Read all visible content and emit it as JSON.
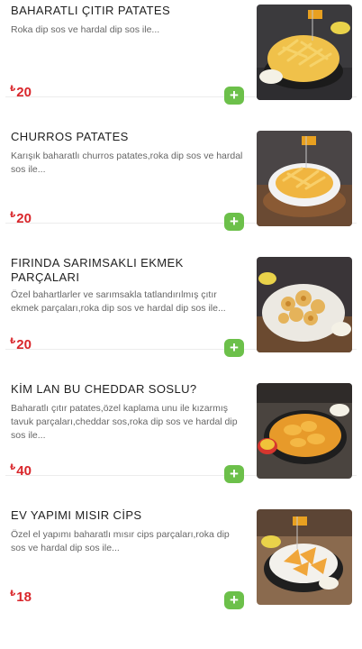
{
  "currency_symbol": "₺",
  "add_label": "+",
  "items": [
    {
      "title": "BAHARATLI ÇITIR PATATES",
      "description": "Roka dip sos ve hardal dip sos ile...",
      "price": "20",
      "image_icon": "fries-basket-photo"
    },
    {
      "title": "CHURROS PATATES",
      "description": "Karışık baharatlı churros patates,roka dip sos ve hardal sos ile...",
      "price": "20",
      "image_icon": "churros-fries-photo"
    },
    {
      "title": "FIRINDA SARIMSAKLI EKMEK PARÇALARI",
      "description": "Özel bahartlarler ve sarımsakla tatlandırılmış çıtır ekmek parçaları,roka dip sos ve hardal dip sos ile...",
      "price": "20",
      "image_icon": "garlic-bread-photo"
    },
    {
      "title": "KİM LAN BU CHEDDAR SOSLU?",
      "description": "Baharatlı çıtır patates,özel kaplama unu ile kızarmış tavuk parçaları,cheddar sos,roka dip sos ve hardal dip sos ile...",
      "price": "40",
      "image_icon": "cheddar-chicken-photo"
    },
    {
      "title": "EV YAPIMI MISIR CİPS",
      "description": "Özel el yapımı baharatlı mısır cips parçaları,roka dip sos ve hardal dip sos ile...",
      "price": "18",
      "image_icon": "corn-chips-photo"
    }
  ],
  "colors": {
    "price": "#d9262b",
    "add_button": "#6cc04a",
    "title": "#1f1f1f",
    "description": "#666666"
  }
}
